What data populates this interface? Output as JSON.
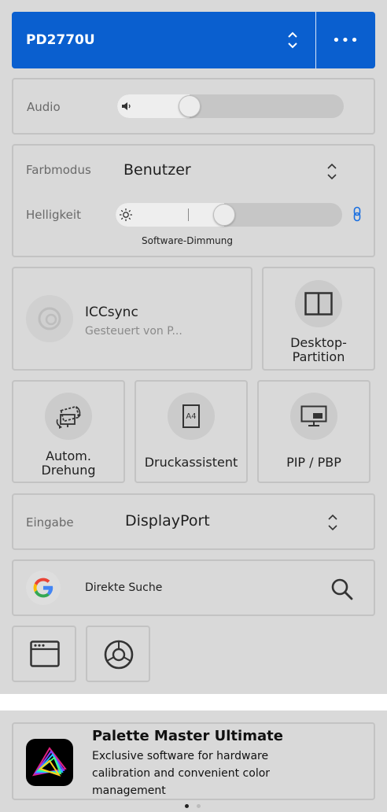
{
  "monitor": {
    "name": "PD2770U"
  },
  "audio": {
    "label": "Audio",
    "level": 0.3
  },
  "color_mode": {
    "label": "Farbmodus",
    "value": "Benutzer"
  },
  "brightness": {
    "label": "Helligkeit",
    "level": 0.45,
    "caption": "Software-Dimmung"
  },
  "iccsync": {
    "title": "ICCsync",
    "subtitle": "Gesteuert von P..."
  },
  "desktop_partition": {
    "label_line1": "Desktop-",
    "label_line2": "Partition"
  },
  "auto_rotate": {
    "label_line1": "Autom.",
    "label_line2": "Drehung"
  },
  "print_assistant": {
    "label": "Druckassistent",
    "icon_text": "A4"
  },
  "pip_pbp": {
    "label": "PIP / PBP"
  },
  "input": {
    "label": "Eingabe",
    "value": "DisplayPort"
  },
  "search": {
    "label": "Direkte Suche"
  },
  "palette_master": {
    "title": "Palette Master Ultimate",
    "line1": "Exclusive software for hardware",
    "line2": "calibration and convenient color",
    "line3": "management"
  },
  "colors": {
    "accent": "#0a5fcf",
    "link_icon": "#1a6fe0"
  }
}
